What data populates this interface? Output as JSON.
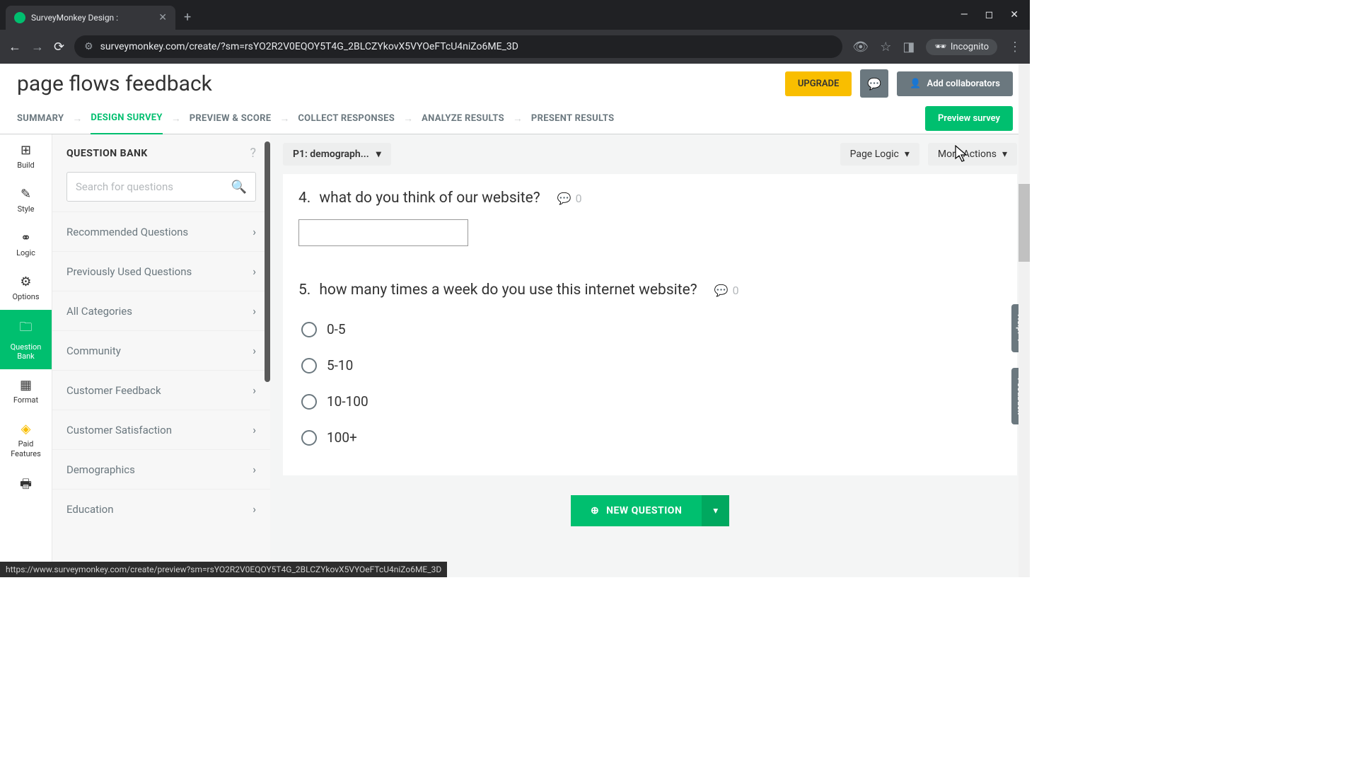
{
  "browser": {
    "tab_title": "SurveyMonkey Design :",
    "url": "surveymonkey.com/create/?sm=rsYO2R2V0EQOY5T4G_2BLCZYkovX5VYOeFTcU4niZo6ME_3D",
    "incognito": "Incognito",
    "status_url": "https://www.surveymonkey.com/create/preview?sm=rsYO2R2V0EQOY5T4G_2BLCZYkovX5VYOeFTcU4niZo6ME_3D"
  },
  "header": {
    "title": "page flows feedback",
    "upgrade": "UPGRADE",
    "collab": "Add collaborators"
  },
  "nav": {
    "items": [
      "SUMMARY",
      "DESIGN SURVEY",
      "PREVIEW & SCORE",
      "COLLECT RESPONSES",
      "ANALYZE RESULTS",
      "PRESENT RESULTS"
    ],
    "active_index": 1,
    "preview_btn": "Preview survey"
  },
  "rail": {
    "items": [
      {
        "label": "Build",
        "icon": "⊞"
      },
      {
        "label": "Style",
        "icon": "✎"
      },
      {
        "label": "Logic",
        "icon": "⚭"
      },
      {
        "label": "Options",
        "icon": "⚙"
      },
      {
        "label": "Question Bank",
        "icon": "🗀"
      },
      {
        "label": "Format",
        "icon": "▦"
      },
      {
        "label": "Paid Features",
        "icon": "◈"
      }
    ],
    "print_icon": "🖶",
    "active_index": 4
  },
  "sidebar": {
    "title": "QUESTION BANK",
    "search_placeholder": "Search for questions",
    "categories": [
      "Recommended Questions",
      "Previously Used Questions",
      "All Categories",
      "Community",
      "Customer Feedback",
      "Customer Satisfaction",
      "Demographics",
      "Education"
    ]
  },
  "content": {
    "page_selector": "P1: demograph...",
    "page_logic": "Page Logic",
    "more_actions": "More Actions",
    "q4": {
      "number": "4.",
      "text": "what do you think of our website?",
      "comments": "0"
    },
    "q5": {
      "number": "5.",
      "text": "how many times a week do you use this internet website?",
      "comments": "0",
      "options": [
        "0-5",
        "5-10",
        "10-100",
        "100+"
      ]
    },
    "new_question": "NEW QUESTION"
  },
  "side_tabs": {
    "help": "Help!",
    "feedback": "Feedback"
  }
}
